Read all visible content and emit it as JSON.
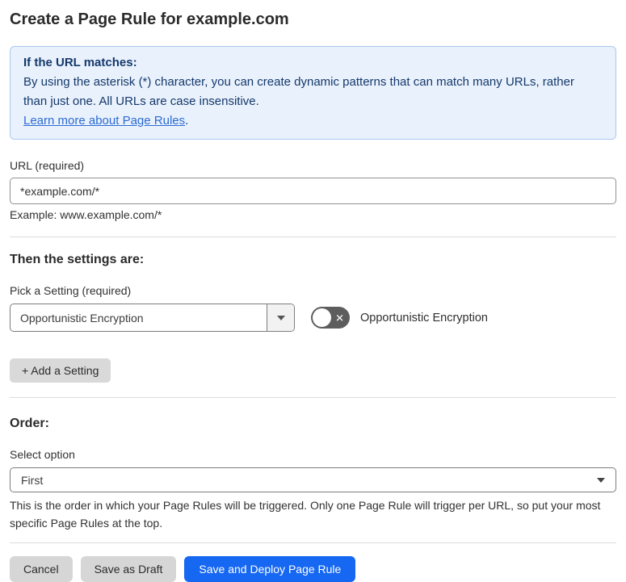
{
  "page": {
    "title": "Create a Page Rule for example.com"
  },
  "info_box": {
    "heading": "If the URL matches:",
    "body": "By using the asterisk (*) character, you can create dynamic patterns that can match many URLs, rather than just one. All URLs are case insensitive.",
    "link_label": "Learn more about Page Rules",
    "link_suffix": "."
  },
  "url_field": {
    "label": "URL (required)",
    "value": "*example.com/*",
    "helper": "Example: www.example.com/*"
  },
  "settings_section": {
    "heading": "Then the settings are:",
    "picker_label": "Pick a Setting (required)",
    "picker_value": "Opportunistic Encryption",
    "toggle": {
      "state": "off",
      "off_glyph": "✕",
      "label": "Opportunistic Encryption"
    },
    "add_button_label": "+ Add a Setting"
  },
  "order_section": {
    "heading": "Order:",
    "select_label": "Select option",
    "select_value": "First",
    "helper": "This is the order in which your Page Rules will be triggered. Only one Page Rule will trigger per URL, so put your most specific Page Rules at the top."
  },
  "footer": {
    "cancel_label": "Cancel",
    "save_draft_label": "Save as Draft",
    "save_deploy_label": "Save and Deploy Page Rule"
  },
  "colors": {
    "info_background": "#e9f1fc",
    "info_border": "#abc9ef",
    "info_text": "#15396b",
    "link": "#2c6bd3",
    "primary_button": "#1667f2",
    "toggle_off": "#5d5d5d",
    "secondary_button": "#d6d6d6"
  }
}
